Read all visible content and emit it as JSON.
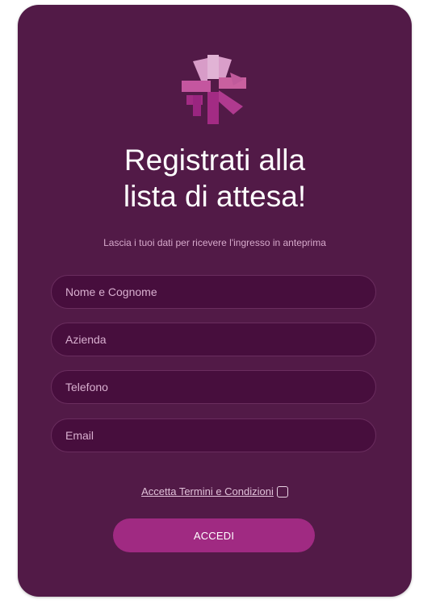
{
  "header": {
    "logo_icon": "pinwheel-logo-icon",
    "title_line1": "Registrati alla",
    "title_line2": "lista di attesa!",
    "subtitle": "Lascia i tuoi dati per ricevere l'ingresso in anteprima"
  },
  "form": {
    "name_placeholder": "Nome e Cognome",
    "name_value": "",
    "company_placeholder": "Azienda",
    "company_value": "",
    "phone_placeholder": "Telefono",
    "phone_value": "",
    "email_placeholder": "Email",
    "email_value": "",
    "terms_label": "Accetta Termini e Condizioni",
    "terms_checked": false,
    "submit_label": "ACCEDI"
  },
  "colors": {
    "card_background": "#521a47",
    "field_background": "#470e3d",
    "button_background": "#a02a82",
    "logo_light": "#d99ec9",
    "logo_mid": "#c4569f",
    "logo_dark": "#a32b84"
  }
}
